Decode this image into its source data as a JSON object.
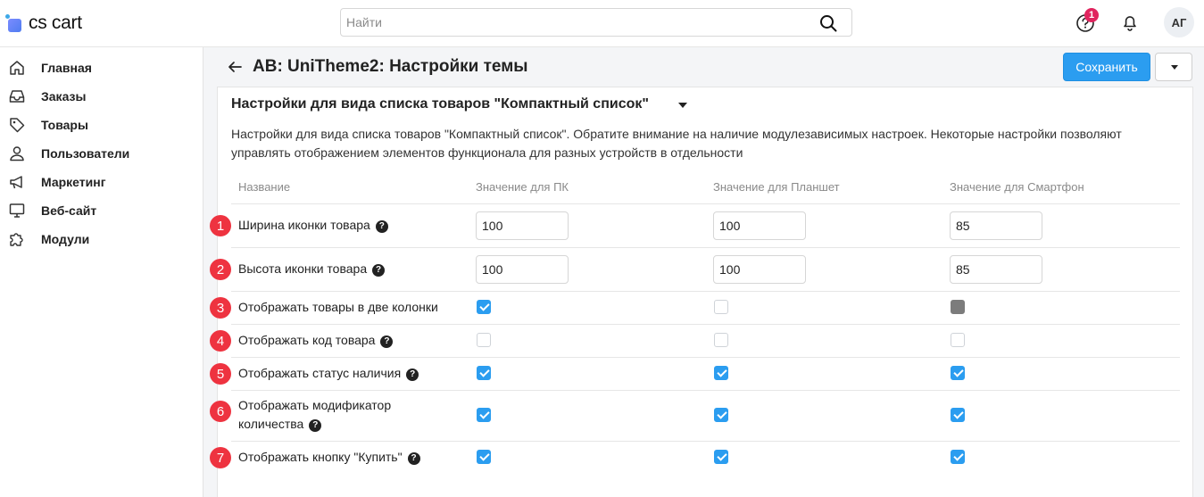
{
  "app": {
    "logo_text": "cs cart"
  },
  "header": {
    "search_placeholder": "Найти",
    "help_badge_count": "1",
    "avatar_initials": "АГ"
  },
  "sidebar": {
    "items": [
      {
        "label": "Главная",
        "icon": "home-icon"
      },
      {
        "label": "Заказы",
        "icon": "inbox-icon"
      },
      {
        "label": "Товары",
        "icon": "tag-icon"
      },
      {
        "label": "Пользователи",
        "icon": "user-icon"
      },
      {
        "label": "Маркетинг",
        "icon": "megaphone-icon"
      },
      {
        "label": "Веб-сайт",
        "icon": "monitor-icon"
      },
      {
        "label": "Модули",
        "icon": "puzzle-icon"
      }
    ]
  },
  "page": {
    "title": "AB: UniTheme2: Настройки темы",
    "save_label": "Сохранить"
  },
  "section": {
    "title": "Настройки для вида списка товаров \"Компактный список\"",
    "description": "Настройки для вида списка товаров \"Компактный список\". Обратите внимание на наличие модулезависимых настроек. Некоторые настройки позволяют управлять отображением элементов функционала для разных устройств в отдельности"
  },
  "table": {
    "columns": [
      "Название",
      "Значение для ПК",
      "Значение для Планшет",
      "Значение для Смартфон"
    ],
    "rows": [
      {
        "marker": "1",
        "label": "Ширина иконки товара",
        "has_help": true,
        "type": "number",
        "values": [
          "100",
          "100",
          "85"
        ]
      },
      {
        "marker": "2",
        "label": "Высота иконки товара",
        "has_help": true,
        "type": "number",
        "values": [
          "100",
          "100",
          "85"
        ]
      },
      {
        "marker": "3",
        "label": "Отображать товары в две колонки",
        "has_help": false,
        "type": "checkbox",
        "values": [
          "checked",
          "unchecked",
          "disabled"
        ]
      },
      {
        "marker": "4",
        "label": "Отображать код товара",
        "has_help": true,
        "type": "checkbox",
        "values": [
          "unchecked",
          "unchecked",
          "unchecked"
        ]
      },
      {
        "marker": "5",
        "label": "Отображать статус наличия",
        "has_help": true,
        "type": "checkbox",
        "values": [
          "checked",
          "checked",
          "checked"
        ]
      },
      {
        "marker": "6",
        "label_line1": "Отображать модификатор",
        "label_line2": "количества",
        "has_help": true,
        "type": "checkbox",
        "values": [
          "checked",
          "checked",
          "checked"
        ]
      },
      {
        "marker": "7",
        "label": "Отображать кнопку \"Купить\"",
        "has_help": true,
        "type": "checkbox",
        "values": [
          "checked",
          "checked",
          "checked"
        ]
      }
    ]
  },
  "colors": {
    "accent": "#2b9df0",
    "marker": "#ee3340",
    "badge": "#e0245e"
  }
}
